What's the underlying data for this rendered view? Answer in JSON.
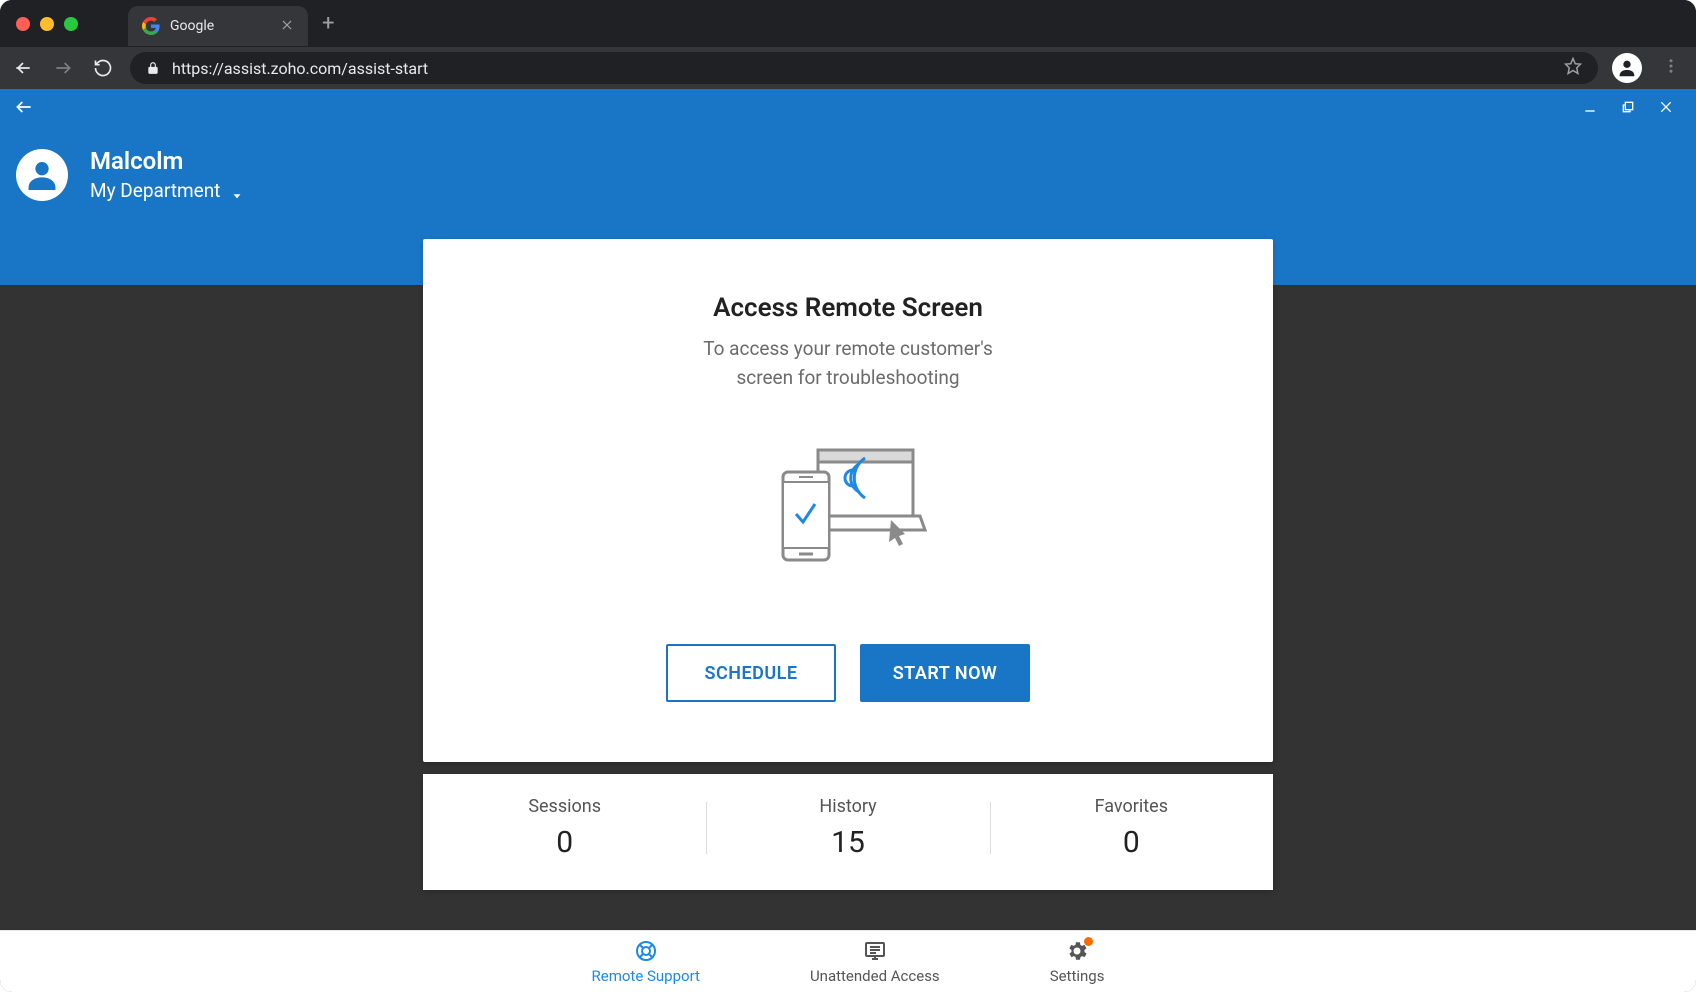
{
  "browser": {
    "tab_title": "Google",
    "url": "https://assist.zoho.com/assist-start"
  },
  "header": {
    "user_name": "Malcolm",
    "department": "My Department"
  },
  "card": {
    "title": "Access Remote Screen",
    "subtitle_line1": "To access your remote customer's",
    "subtitle_line2": "screen for troubleshooting",
    "schedule_label": "SCHEDULE",
    "start_label": "START NOW"
  },
  "stats": {
    "sessions_label": "Sessions",
    "sessions_value": "0",
    "history_label": "History",
    "history_value": "15",
    "favorites_label": "Favorites",
    "favorites_value": "0"
  },
  "bottom_nav": {
    "remote_support": "Remote Support",
    "unattended_access": "Unattended Access",
    "settings": "Settings"
  }
}
